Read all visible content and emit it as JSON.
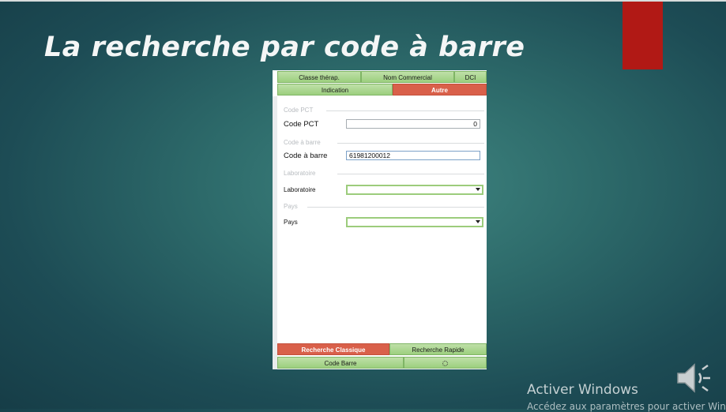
{
  "slide": {
    "title": "La recherche par code à barre"
  },
  "panel": {
    "top_tabs": [
      "Classe thérap.",
      "Nom Commercial",
      "DCI"
    ],
    "second_tabs": [
      {
        "label": "Indication",
        "active": false
      },
      {
        "label": "Autre",
        "active": true
      }
    ],
    "groups": {
      "code_pct": "Code PCT",
      "code_barre": "Code à barre",
      "laboratoire": "Laboratoire",
      "pays": "Pays"
    },
    "fields": {
      "code_pct": {
        "label": "Code PCT",
        "value": "0"
      },
      "code_barre": {
        "label": "Code à barre",
        "value": "61981200012"
      },
      "laboratoire": {
        "label": "Laboratoire",
        "value": ""
      },
      "pays": {
        "label": "Pays",
        "value": ""
      }
    },
    "bottom_tabs": [
      {
        "label": "Recherche Classique",
        "active": true
      },
      {
        "label": "Recherche Rapide",
        "active": false
      }
    ],
    "bottom_row": {
      "code_barre_label": "Code Barre",
      "icon": "gear-icon"
    }
  },
  "watermark": {
    "title": "Activer Windows",
    "subtitle": "Accédez aux paramètres pour activer Windows"
  },
  "colors": {
    "accent_red": "#b11915",
    "tab_active": "#d9604a",
    "tab_green": "#9ccf7e"
  }
}
